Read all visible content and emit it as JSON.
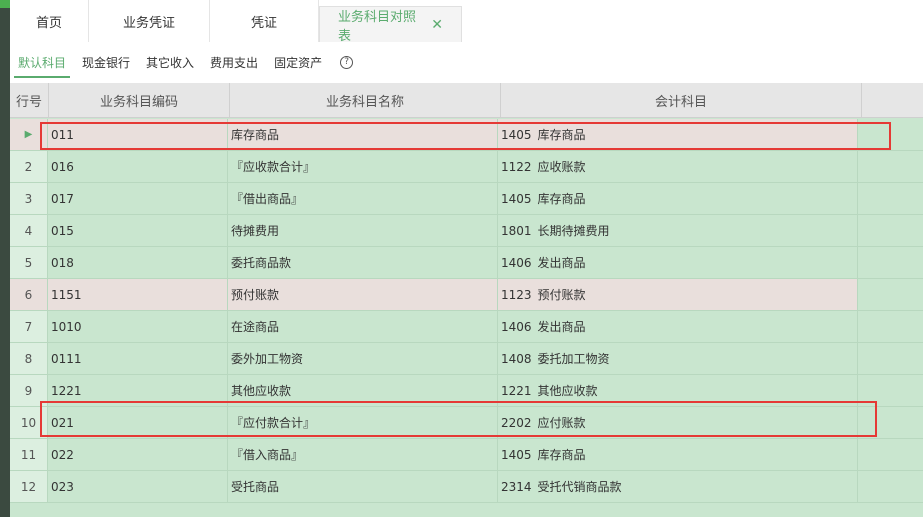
{
  "top_tabs": [
    {
      "label": "首页"
    },
    {
      "label": "业务凭证"
    },
    {
      "label": "凭证"
    },
    {
      "label": "业务科目对照表",
      "close": "✕"
    }
  ],
  "sub_tabs": [
    {
      "label": "默认科目"
    },
    {
      "label": "现金银行"
    },
    {
      "label": "其它收入"
    },
    {
      "label": "费用支出"
    },
    {
      "label": "固定资产"
    }
  ],
  "help_icon": "?",
  "columns": {
    "row_no": "行号",
    "code": "业务科目编码",
    "name": "业务科目名称",
    "account": "会计科目"
  },
  "rows": [
    {
      "idx": "▶",
      "code": "011",
      "name": "库存商品",
      "acct_code": "1405",
      "acct_name": "库存商品"
    },
    {
      "idx": "2",
      "code": "016",
      "name": "『应收款合计』",
      "acct_code": "1122",
      "acct_name": "应收账款"
    },
    {
      "idx": "3",
      "code": "017",
      "name": "『借出商品』",
      "acct_code": "1405",
      "acct_name": "库存商品"
    },
    {
      "idx": "4",
      "code": "015",
      "name": "待摊费用",
      "acct_code": "1801",
      "acct_name": "长期待摊费用"
    },
    {
      "idx": "5",
      "code": "018",
      "name": "委托商品款",
      "acct_code": "1406",
      "acct_name": "发出商品"
    },
    {
      "idx": "6",
      "code": "1151",
      "name": "预付账款",
      "acct_code": "1123",
      "acct_name": "预付账款"
    },
    {
      "idx": "7",
      "code": "1010",
      "name": "在途商品",
      "acct_code": "1406",
      "acct_name": "发出商品"
    },
    {
      "idx": "8",
      "code": "0111",
      "name": "委外加工物资",
      "acct_code": "1408",
      "acct_name": "委托加工物资"
    },
    {
      "idx": "9",
      "code": "1221",
      "name": "其他应收款",
      "acct_code": "1221",
      "acct_name": "其他应收款"
    },
    {
      "idx": "10",
      "code": "021",
      "name": "『应付款合计』",
      "acct_code": "2202",
      "acct_name": "应付账款"
    },
    {
      "idx": "11",
      "code": "022",
      "name": "『借入商品』",
      "acct_code": "1405",
      "acct_name": "库存商品"
    },
    {
      "idx": "12",
      "code": "023",
      "name": "受托商品",
      "acct_code": "2314",
      "acct_name": "受托代销商品款"
    }
  ],
  "colors": {
    "accent": "#5aab6e",
    "row_bg": "#c9e6cf",
    "selected_row_bg": "#e9dfdc",
    "highlight_border": "#e53935"
  }
}
